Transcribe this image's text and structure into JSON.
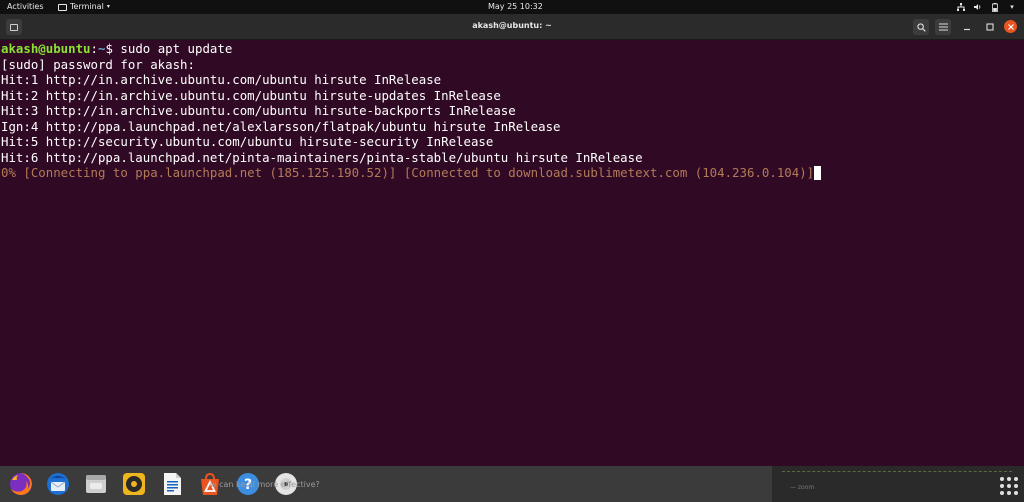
{
  "topbar": {
    "activities": "Activities",
    "app_menu": "Terminal",
    "clock": "May 25  10:32"
  },
  "window": {
    "title": "akash@ubuntu: ~"
  },
  "terminal": {
    "prompt": {
      "user_host": "akash@ubuntu",
      "separator": ":",
      "path": "~",
      "symbol": "$",
      "command": " sudo apt update"
    },
    "lines": [
      "[sudo] password for akash:",
      "Hit:1 http://in.archive.ubuntu.com/ubuntu hirsute InRelease",
      "Hit:2 http://in.archive.ubuntu.com/ubuntu hirsute-updates InRelease",
      "Hit:3 http://in.archive.ubuntu.com/ubuntu hirsute-backports InRelease",
      "Ign:4 http://ppa.launchpad.net/alexlarsson/flatpak/ubuntu hirsute InRelease",
      "Hit:5 http://security.ubuntu.com/ubuntu hirsute-security InRelease",
      "Hit:6 http://ppa.launchpad.net/pinta-maintainers/pinta-stable/ubuntu hirsute InRelease"
    ],
    "progress_line": "0% [Connecting to ppa.launchpad.net (185.125.190.52)] [Connected to download.sublimetext.com (104.236.0.104)]"
  },
  "dock": {
    "caption": "w can       ke       al more effective?",
    "right_label": "— zoom",
    "icons": [
      "firefox-icon",
      "thunderbird-icon",
      "files-icon",
      "rhythmbox-icon",
      "libreoffice-writer-icon",
      "ubuntu-software-icon",
      "help-icon",
      "disc-icon"
    ]
  },
  "colors": {
    "terminal_bg": "#300a24",
    "prompt_user": "#8ae234",
    "prompt_path": "#729fcf",
    "progress_text": "#b37a58",
    "close_button": "#e95420"
  }
}
